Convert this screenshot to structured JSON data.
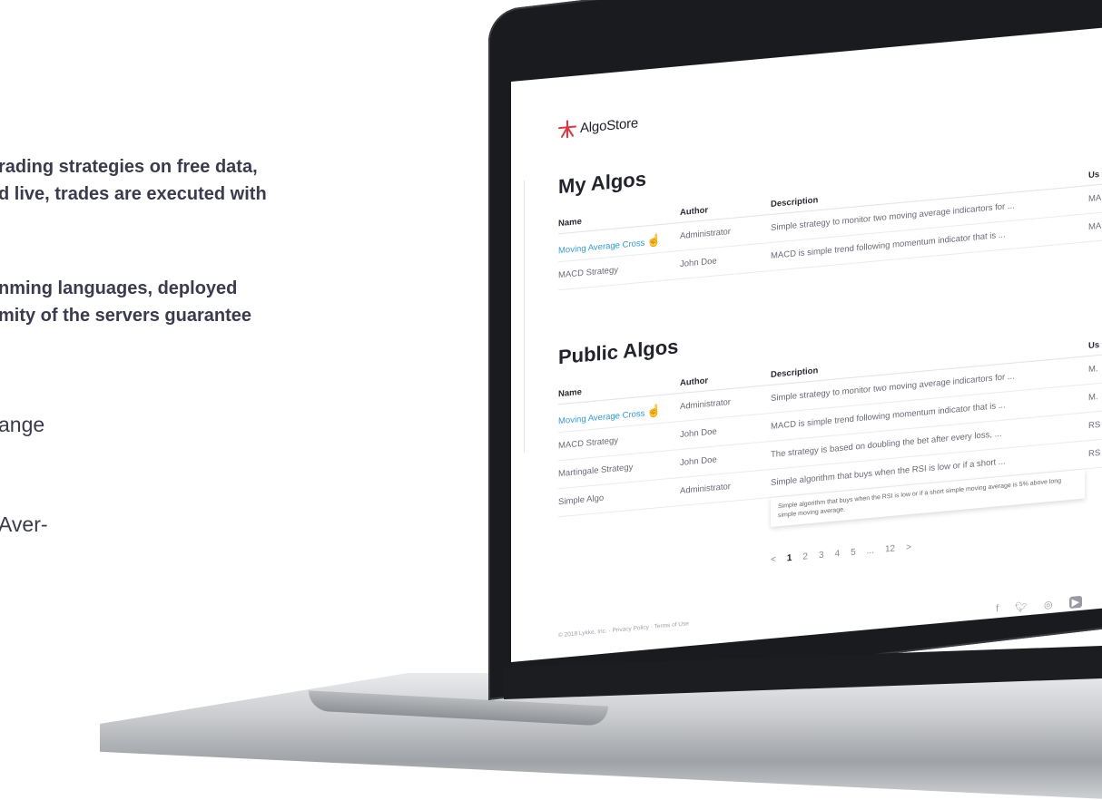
{
  "marketing": {
    "line1": "rading strategies on free data,",
    "line2": "d live, trades are executed with",
    "line3": "nming languages, deployed",
    "line4": "mity of the servers guarantee",
    "line5": "ange",
    "line6": "Aver-"
  },
  "app": {
    "logo_text": "AlgoStore",
    "my_algos": {
      "title": "My Algos",
      "headers": [
        "Name",
        "Author",
        "Description",
        "Us"
      ],
      "rows": [
        {
          "name": "Moving Average Cross",
          "author": "Administrator",
          "description": "Simple strategy to monitor two moving average indicartors for ...",
          "use": "MA"
        },
        {
          "name": "MACD Strategy",
          "author": "John Doe",
          "description": "MACD is simple trend following momentum indicator that is ...",
          "use": "MA"
        }
      ]
    },
    "public_algos": {
      "title": "Public Algos",
      "headers": [
        "Name",
        "Author",
        "Description",
        "Us"
      ],
      "rows": [
        {
          "name": "Moving Average Cross",
          "author": "Administrator",
          "description": "Simple strategy to monitor two moving average indicartors for ...",
          "use": "M."
        },
        {
          "name": "MACD Strategy",
          "author": "John Doe",
          "description": "MACD is simple trend following momentum indicator that is ...",
          "use": "M."
        },
        {
          "name": "Martingale Strategy",
          "author": "John Doe",
          "description": "The strategy is based on doubling the bet after every loss, ...",
          "use": "RS"
        },
        {
          "name": "Simple Algo",
          "author": "Administrator",
          "description": "Simple algorithm that buys when the RSI is low or if a short ...",
          "use": "RS"
        }
      ],
      "tooltip": "Simple algorithm that buys when the RSI is low or if a short simple moving average is 5% above long simple moving average."
    },
    "pagination": {
      "prev": "<",
      "pages": [
        "1",
        "2",
        "3",
        "4",
        "5",
        "...",
        "12"
      ],
      "next": ">"
    },
    "footer": {
      "copyright": "© 2018 Lykke, Inc. · Privacy Policy · Terms of Use"
    },
    "social_icons": [
      "facebook-icon",
      "twitter-icon",
      "instagram-icon",
      "youtube-icon"
    ]
  }
}
